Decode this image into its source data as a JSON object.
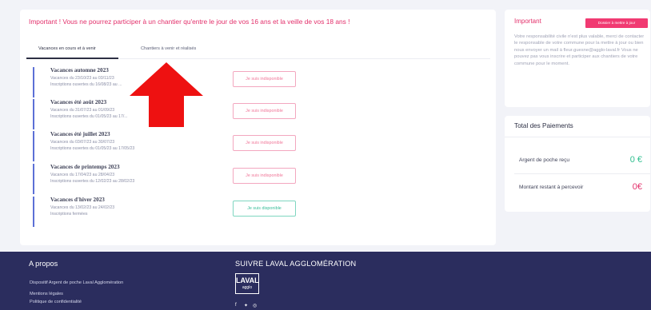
{
  "banner": "Important !   Vous ne pourrez participer à un chantier qu'entre le jour de vos 16 ans et la veille de vos 18 ans !",
  "tabs": [
    {
      "label": "Vacances en cours et à venir",
      "active": true
    },
    {
      "label": "Chantiers à venir et réalisés",
      "active": false
    }
  ],
  "items": [
    {
      "title": "Vacances automne 2023",
      "dates": "Vacances du 23/10/23 au 03/11/23",
      "registrations": "Inscriptions ouvertes du 16/08/23 au ...",
      "button": "Je suis indisponible",
      "status": "unavailable"
    },
    {
      "title": "Vacances été août 2023",
      "dates": "Vacances du 31/07/23 au 01/09/23",
      "registrations": "Inscriptions ouvertes du 01/05/23 au 17/...",
      "button": "Je suis indisponible",
      "status": "unavailable"
    },
    {
      "title": "Vacances été juillet 2023",
      "dates": "Vacances du 03/07/23 au 30/07/23",
      "registrations": "Inscriptions ouvertes du 01/05/23 au 17/05/23",
      "button": "Je suis indisponible",
      "status": "unavailable"
    },
    {
      "title": "Vacances de printemps 2023",
      "dates": "Vacances du 17/04/23 au 28/04/23",
      "registrations": "Inscriptions ouvertes du 12/02/23 au 28/02/23",
      "button": "Je suis indisponible",
      "status": "unavailable"
    },
    {
      "title": "Vacances d'hiver 2023",
      "dates": "Vacances du 13/02/23 au 24/02/23",
      "registrations": "Inscriptions fermées",
      "button": "Je suis disponible",
      "status": "available"
    }
  ],
  "important": {
    "title": "Important",
    "badge": "Dossier à mettre à jour",
    "text": "Votre responsabilité civile n'est plus valable, merci de contacter le responsable de votre commune pour la mettre à jour ou bien nous envoyer un mail à fleur.guesne@agglo-laval.fr Vous ne pouvez pas vous inscrire et participer aux chantiers de votre commune pour le moment."
  },
  "payments": {
    "title": "Total des Paiements",
    "received_label": "Argent de poche reçu",
    "received_value": "0 €",
    "remaining_label": "Montant restant à percevoir",
    "remaining_value": "0€"
  },
  "footer": {
    "about_title": "A propos",
    "links": [
      "Dispositif Argent de poche Laval Agglomération",
      "Mentions légales",
      "Politique de confidentialité"
    ],
    "follow_title": "SUIVRE LAVAL AGGLOMÉRATION",
    "logo_main": "LAVAL",
    "logo_sub": "agglo"
  },
  "colors": {
    "accent_pink": "#e3306b",
    "badge_pink": "#f13a72",
    "item_bar": "#5c70d6",
    "available_green": "#37bd98",
    "footer_bg": "#2b2d5e",
    "arrow_red": "#ee1111"
  },
  "icons": [
    "facebook-icon",
    "twitter-icon",
    "instagram-icon",
    "red-arrow-annotation"
  ]
}
